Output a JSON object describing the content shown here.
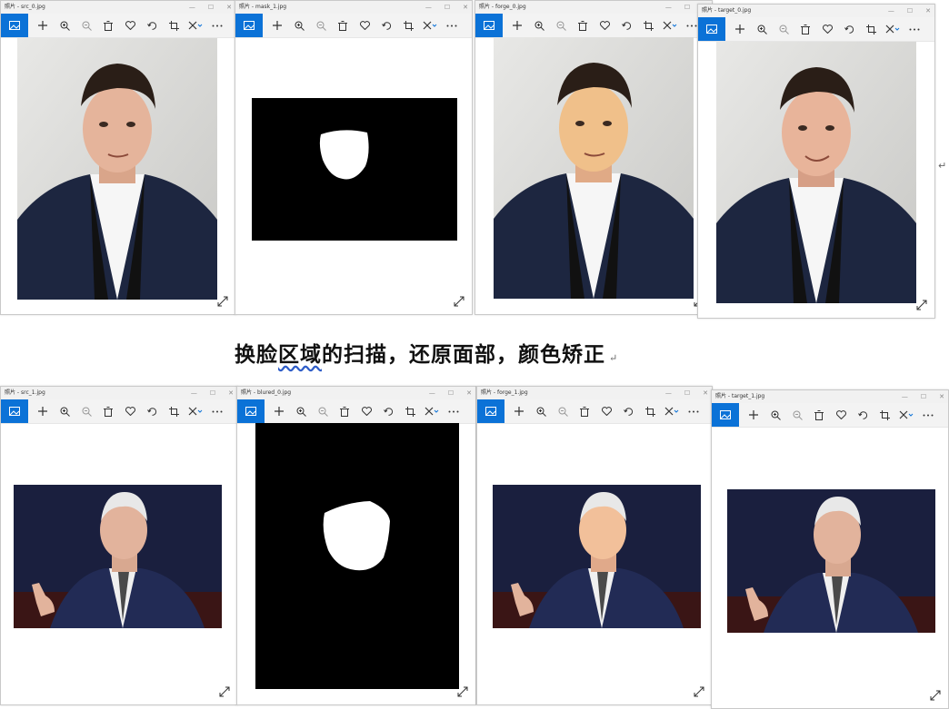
{
  "windows": [
    {
      "title": "照片 - src_0.jpg",
      "content": "portrait"
    },
    {
      "title": "照片 - mask_1.jpg",
      "content": "mask"
    },
    {
      "title": "照片 - forge_0.jpg",
      "content": "portrait"
    },
    {
      "title": "照片 - target_0.jpg",
      "content": "portrait"
    },
    {
      "title": "照片 - src_1.jpg",
      "content": "speaker"
    },
    {
      "title": "照片 - blured_0.jpg",
      "content": "mask"
    },
    {
      "title": "照片 - forge_1.jpg",
      "content": "speaker"
    },
    {
      "title": "照片 - target_1.jpg",
      "content": "speaker"
    }
  ],
  "caption": {
    "part1": "换脸",
    "part2": "区域",
    "part3": "的扫描，还原面部，颜色矫正",
    "mark": "↵"
  },
  "side_mark": "↵",
  "colors": {
    "accent": "#0b72d7",
    "mask_bg": "#000000",
    "mask_fg": "#ffffff"
  },
  "toolbar_icons": [
    "photo-view-icon",
    "add-icon",
    "zoom-in-icon",
    "zoom-out-icon",
    "delete-icon",
    "favorite-icon",
    "rotate-icon",
    "crop-icon",
    "edit-icon",
    "more-icon"
  ]
}
